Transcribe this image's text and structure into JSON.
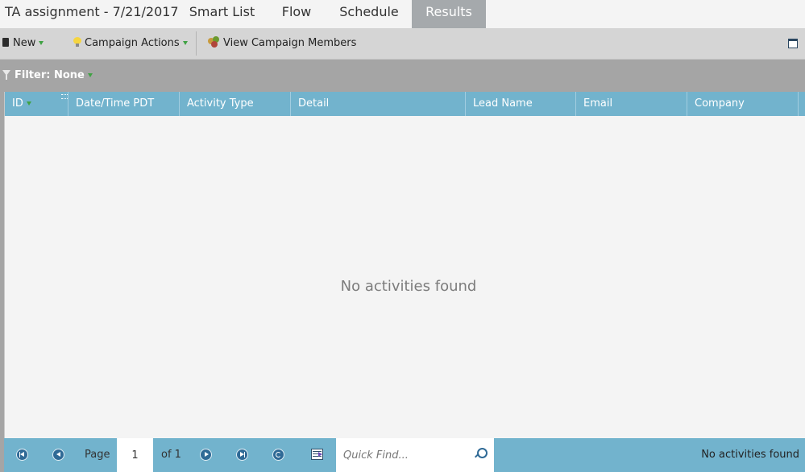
{
  "header": {
    "title": "TA assignment - 7/21/2017",
    "tabs": [
      {
        "label": "Smart List",
        "active": false
      },
      {
        "label": "Flow",
        "active": false
      },
      {
        "label": "Schedule",
        "active": false
      },
      {
        "label": "Results",
        "active": true
      }
    ]
  },
  "toolbar": {
    "new_label": "New",
    "campaign_actions_label": "Campaign Actions",
    "view_members_label": "View Campaign Members",
    "icons": [
      "new-icon",
      "lightbulb-icon",
      "members-icon",
      "maximize-icon"
    ]
  },
  "filter": {
    "label": "Filter: None"
  },
  "grid": {
    "columns": [
      "ID",
      "Date/Time PDT",
      "Activity Type",
      "Detail",
      "Lead Name",
      "Email",
      "Company"
    ],
    "empty_message": "No activities found",
    "header_color": "#72b3cd"
  },
  "pager": {
    "page_label": "Page",
    "page_value": "1",
    "of_label": "of 1",
    "quick_find_placeholder": "Quick Find...",
    "status": "No activities found"
  }
}
